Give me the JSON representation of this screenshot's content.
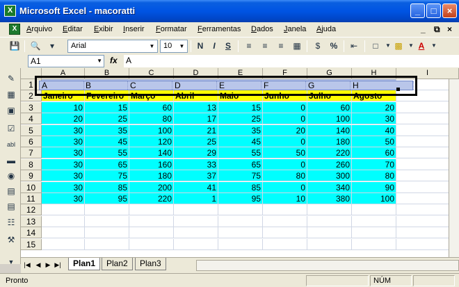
{
  "window": {
    "title": "Microsoft Excel - macoratti",
    "icon_label": "X"
  },
  "menu": {
    "items": [
      "Arquivo",
      "Editar",
      "Exibir",
      "Inserir",
      "Formatar",
      "Ferramentas",
      "Dados",
      "Janela",
      "Ajuda"
    ],
    "minimize": "_",
    "restore": "Ē",
    "close": "×"
  },
  "toolbar": {
    "font_name": "Arial",
    "font_size": "10",
    "bold": "N",
    "italic": "I",
    "underline": "S",
    "percent": "%"
  },
  "formula_bar": {
    "name_box": "A1",
    "fx": "fx",
    "value": "A"
  },
  "sheet": {
    "columns": [
      "A",
      "B",
      "C",
      "D",
      "E",
      "F",
      "G",
      "H",
      "I"
    ],
    "row_numbers": [
      "1",
      "2",
      "3",
      "4",
      "5",
      "6",
      "7",
      "8",
      "9",
      "10",
      "11",
      "12",
      "13",
      "14",
      "15"
    ],
    "header_row": [
      "A",
      "B",
      "C",
      "D",
      "E",
      "F",
      "G",
      "H"
    ],
    "month_row": [
      "Janeiro",
      "Fevereiro",
      "Março",
      "Abril",
      "Maio",
      "Junho",
      "Julho",
      "Agosto"
    ],
    "data_rows": [
      [
        "10",
        "15",
        "60",
        "13",
        "15",
        "0",
        "60",
        "20"
      ],
      [
        "20",
        "25",
        "80",
        "17",
        "25",
        "0",
        "100",
        "30"
      ],
      [
        "30",
        "35",
        "100",
        "21",
        "35",
        "20",
        "140",
        "40"
      ],
      [
        "30",
        "45",
        "120",
        "25",
        "45",
        "0",
        "180",
        "50"
      ],
      [
        "30",
        "55",
        "140",
        "29",
        "55",
        "50",
        "220",
        "60"
      ],
      [
        "30",
        "65",
        "160",
        "33",
        "65",
        "0",
        "260",
        "70"
      ],
      [
        "30",
        "75",
        "180",
        "37",
        "75",
        "80",
        "300",
        "80"
      ],
      [
        "30",
        "85",
        "200",
        "41",
        "85",
        "0",
        "340",
        "90"
      ],
      [
        "30",
        "95",
        "220",
        "1",
        "95",
        "10",
        "380",
        "100"
      ]
    ]
  },
  "sheet_tabs": [
    "Plan1",
    "Plan2",
    "Plan3"
  ],
  "status": {
    "left": "Pronto",
    "num": "NÚM"
  }
}
